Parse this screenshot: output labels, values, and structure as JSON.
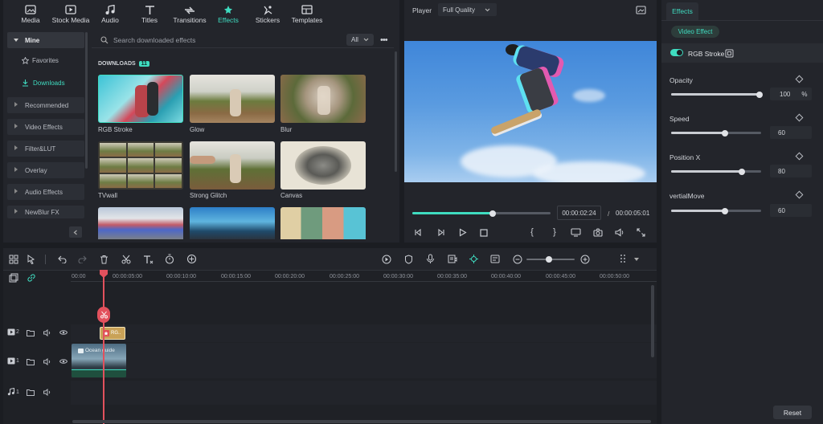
{
  "toolbar": {
    "items": [
      {
        "label": "Media",
        "icon": "media-icon"
      },
      {
        "label": "Stock Media",
        "icon": "stock-media-icon"
      },
      {
        "label": "Audio",
        "icon": "audio-icon"
      },
      {
        "label": "Titles",
        "icon": "titles-icon"
      },
      {
        "label": "Transitions",
        "icon": "transitions-icon"
      },
      {
        "label": "Effects",
        "icon": "effects-icon",
        "active": true
      },
      {
        "label": "Stickers",
        "icon": "stickers-icon"
      },
      {
        "label": "Templates",
        "icon": "templates-icon"
      }
    ]
  },
  "sidebar": {
    "mine": "Mine",
    "favorites": "Favorites",
    "downloads": "Downloads",
    "categories": [
      "Recommended",
      "Video Effects",
      "Filter&LUT",
      "Overlay",
      "Audio Effects",
      "NewBlur FX"
    ]
  },
  "browser": {
    "search_placeholder": "Search downloaded effects",
    "filter": "All",
    "section_title": "DOWNLOADS",
    "section_count": "11",
    "effects": [
      "RGB Stroke",
      "Glow",
      "Blur",
      "TVwall",
      "Strong Glitch",
      "Canvas"
    ]
  },
  "player": {
    "title": "Player",
    "quality": "Full Quality",
    "current_time": "00:00:02:24",
    "separator": "/",
    "total_time": "00:00:05:01",
    "progress": 0.58
  },
  "effects_panel": {
    "tab": "Effects",
    "subtab": "Video Effect",
    "effect_name": "RGB Stroke",
    "properties": [
      {
        "label": "Opacity",
        "value": "100",
        "unit": "%",
        "level": 1.0
      },
      {
        "label": "Speed",
        "value": "60",
        "unit": "",
        "level": 0.6
      },
      {
        "label": "Position X",
        "value": "80",
        "unit": "",
        "level": 0.8
      },
      {
        "label": "vertialMove",
        "value": "60",
        "unit": "",
        "level": 0.6
      }
    ],
    "reset": "Reset"
  },
  "timeline": {
    "ruler": [
      "00:00",
      "00:00:05:00",
      "00:00:10:00",
      "00:00:15:00",
      "00:00:20:00",
      "00:00:25:00",
      "00:00:30:00",
      "00:00:35:00",
      "00:00:40:00",
      "00:00:45:00",
      "00:00:50:00"
    ],
    "track2_label": "2",
    "track1_label": "1",
    "audio_label": "1",
    "effect_clip": "RG..",
    "video_clip": "Ocean guide"
  },
  "colors": {
    "accent": "#3fdcc0",
    "bg": "#1b1d22",
    "panel": "#23252b",
    "playhead": "#e2515d"
  }
}
